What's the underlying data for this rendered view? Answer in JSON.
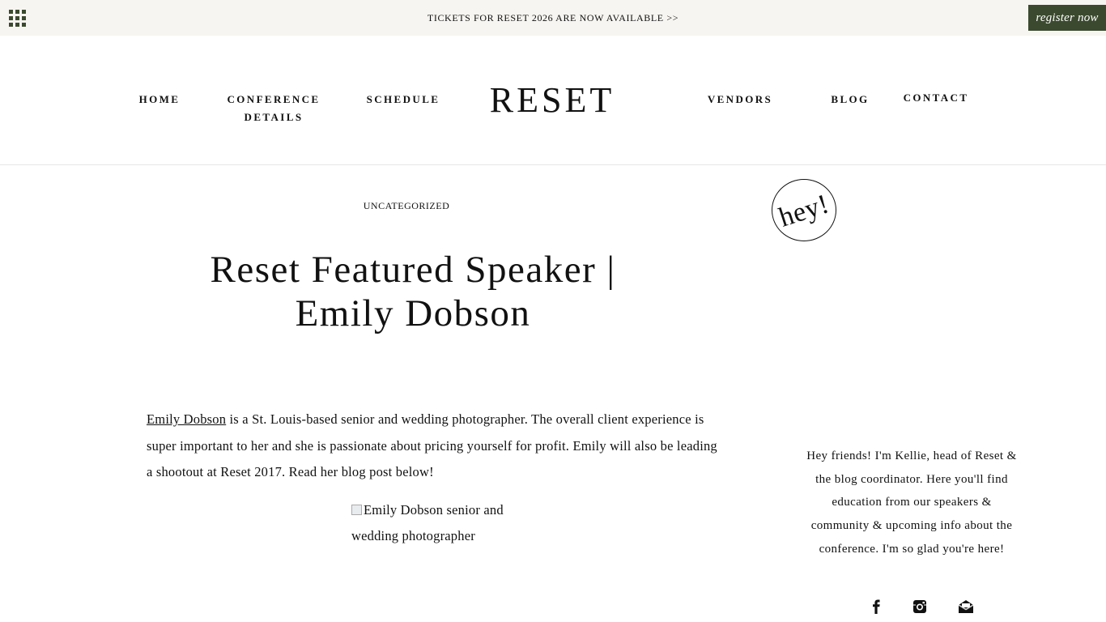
{
  "topbar": {
    "announcement": "TICKETS FOR RESET 2026 ARE NOW AVAILABLE >>",
    "register_label": "register now",
    "menu_icon": "grid-menu-icon"
  },
  "nav": {
    "logo": "RESET",
    "items": [
      "HOME",
      "CONFERENCE DETAILS",
      "SCHEDULE",
      "VENDORS",
      "BLOG",
      "CONTACT"
    ]
  },
  "post": {
    "category": "UNCATEGORIZED",
    "title": "Reset Featured Speaker | Emily Dobson",
    "intro_link": "Emily Dobson",
    "intro_rest": " is a St. Louis-based senior and wedding photographer.  The overall client experience is super important to her and she is passionate about pricing yourself for profit.  Emily will also be leading a shootout at Reset 2017.  Read her blog post below!",
    "image_alt": "Emily Dobson senior and wedding photographer"
  },
  "sidebar": {
    "badge": "hey!",
    "intro": "Hey friends! I'm Kellie, head of Reset & the blog coordinator. Here you'll find education from our speakers & community & upcoming info about the conference. I'm so glad you're here!",
    "social_icons": [
      "facebook-icon",
      "instagram-icon",
      "email-icon"
    ]
  },
  "colors": {
    "accent": "#3b4a2e",
    "topbar_bg": "#f7f5f1",
    "text": "#111111"
  }
}
